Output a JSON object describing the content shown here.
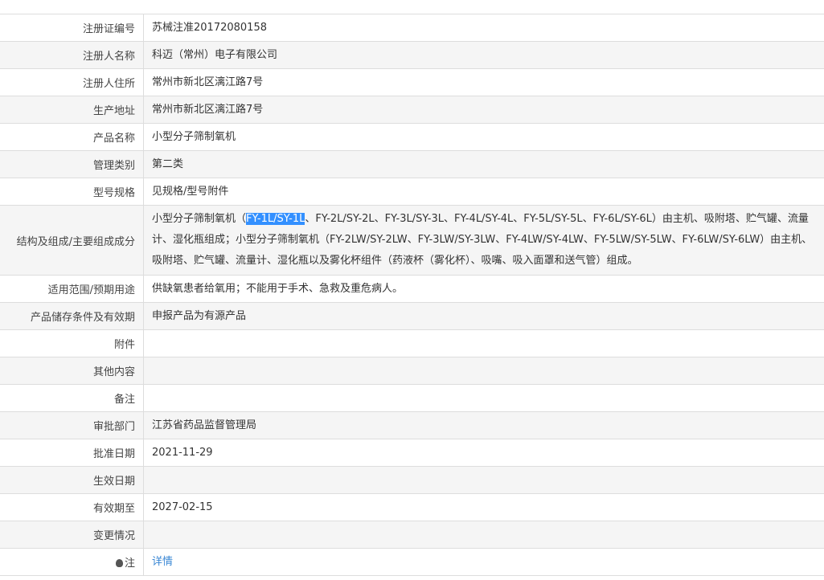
{
  "rows": [
    {
      "label": "注册证编号",
      "value": "苏械注准20172080158"
    },
    {
      "label": "注册人名称",
      "value": "科迈（常州）电子有限公司"
    },
    {
      "label": "注册人住所",
      "value": "常州市新北区漓江路7号"
    },
    {
      "label": "生产地址",
      "value": "常州市新北区漓江路7号"
    },
    {
      "label": "产品名称",
      "value": "小型分子筛制氧机"
    },
    {
      "label": "管理类别",
      "value": "第二类"
    },
    {
      "label": "型号规格",
      "value": "见规格/型号附件"
    },
    {
      "label": "结构及组成/主要组成成分",
      "value_pre": "小型分子筛制氧机（",
      "value_selected": "FY-1L/SY-1L",
      "value_post": "、FY-2L/SY-2L、FY-3L/SY-3L、FY-4L/SY-4L、FY-5L/SY-5L、FY-6L/SY-6L）由主机、吸附塔、贮气罐、流量计、湿化瓶组成；小型分子筛制氧机（FY-2LW/SY-2LW、FY-3LW/SY-3LW、FY-4LW/SY-4LW、FY-5LW/SY-5LW、FY-6LW/SY-6LW）由主机、吸附塔、贮气罐、流量计、湿化瓶以及雾化杯组件（药液杯（雾化杯）、吸嘴、吸入面罩和送气管）组成。"
    },
    {
      "label": "适用范围/预期用途",
      "value": "供缺氧患者给氧用；不能用于手术、急救及重危病人。"
    },
    {
      "label": "产品储存条件及有效期",
      "value": "申报产品为有源产品"
    },
    {
      "label": "附件",
      "value": ""
    },
    {
      "label": "其他内容",
      "value": ""
    },
    {
      "label": "备注",
      "value": ""
    },
    {
      "label": "审批部门",
      "value": "江苏省药品监督管理局"
    },
    {
      "label": "批准日期",
      "value": "2021-11-29"
    },
    {
      "label": "生效日期",
      "value": ""
    },
    {
      "label": "有效期至",
      "value": "2027-02-15"
    },
    {
      "label": "变更情况",
      "value": ""
    },
    {
      "label": "注",
      "link": "详情"
    }
  ]
}
